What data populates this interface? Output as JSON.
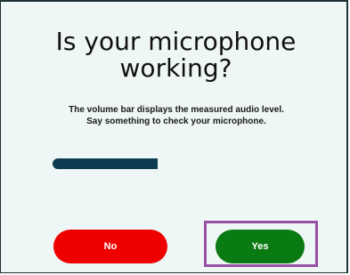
{
  "dialog": {
    "title": "Is your microphone working?",
    "description": "The volume bar displays the measured audio level. Say something to check your microphone.",
    "volume_level": 0.48,
    "volume_color": "#0d3d52"
  },
  "buttons": {
    "no_label": "No",
    "yes_label": "Yes",
    "no_color": "#ee0000",
    "yes_color": "#0a7a12",
    "highlight_color": "#9a4fa6"
  }
}
